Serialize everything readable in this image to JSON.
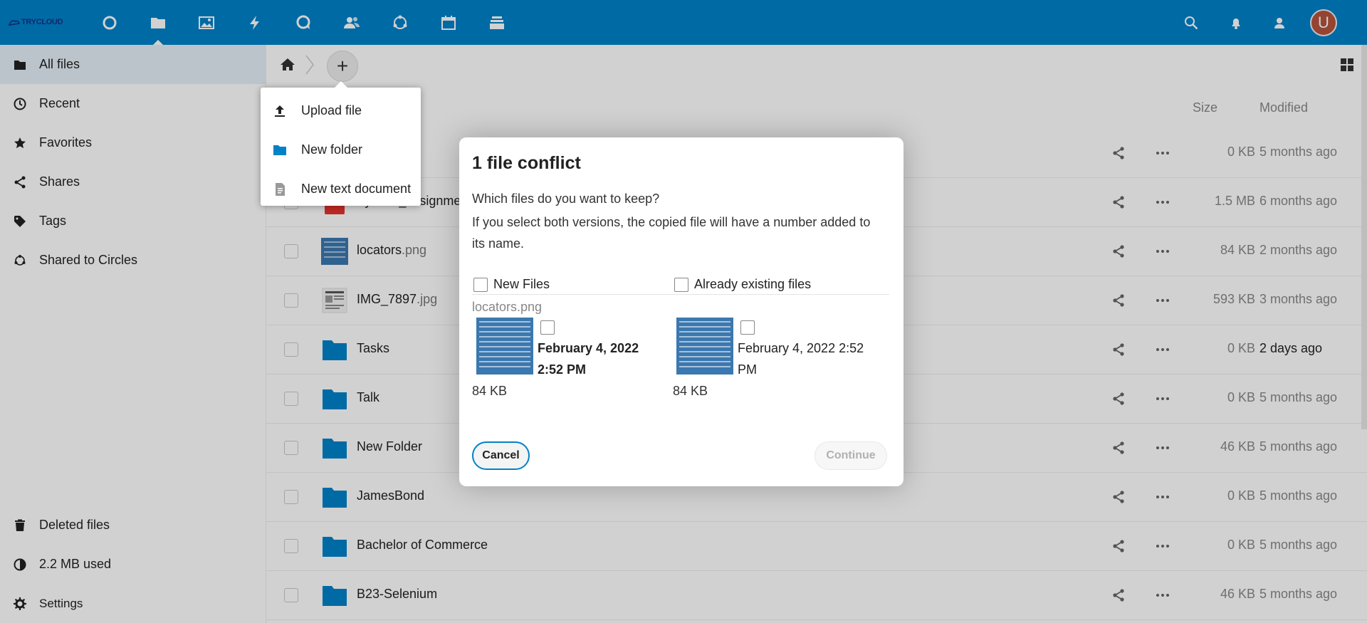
{
  "header": {
    "logo_text": "TRYCLOUD",
    "apps": [
      "dashboard-icon",
      "files-icon",
      "photos-icon",
      "activity-icon",
      "talk-icon",
      "contacts-icon",
      "circles-icon",
      "calendar-icon",
      "deck-icon"
    ],
    "avatar_letter": "U",
    "accent": "#0082c9"
  },
  "sidebar": {
    "items": [
      {
        "label": "All files",
        "icon": "folder-icon"
      },
      {
        "label": "Recent",
        "icon": "clock-icon"
      },
      {
        "label": "Favorites",
        "icon": "star-icon"
      },
      {
        "label": "Shares",
        "icon": "share-icon"
      },
      {
        "label": "Tags",
        "icon": "tag-icon"
      },
      {
        "label": "Shared to Circles",
        "icon": "circles-icon"
      }
    ],
    "bottom": {
      "deleted": "Deleted files",
      "quota": "2.2 MB used",
      "settings": "Settings"
    }
  },
  "files": {
    "columns": {
      "size": "Size",
      "modified": "Modified"
    },
    "rows": [
      {
        "name": "",
        "ext": "",
        "size": "0 KB",
        "modified": "5 months ago"
      },
      {
        "name": "Vytrack_assignment",
        "ext": "",
        "size": "1.5 MB",
        "modified": "6 months ago"
      },
      {
        "name": "locators",
        "ext": ".png",
        "size": "84 KB",
        "modified": "2 months ago"
      },
      {
        "name": "IMG_7897",
        "ext": ".jpg",
        "size": "593 KB",
        "modified": "3 months ago"
      },
      {
        "name": "Tasks",
        "ext": "",
        "size": "0 KB",
        "modified": "2 days ago"
      },
      {
        "name": "Talk",
        "ext": "",
        "size": "0 KB",
        "modified": "5 months ago"
      },
      {
        "name": "New Folder",
        "ext": "",
        "size": "46 KB",
        "modified": "5 months ago"
      },
      {
        "name": "JamesBond",
        "ext": "",
        "size": "0 KB",
        "modified": "5 months ago"
      },
      {
        "name": "Bachelor of Commerce",
        "ext": "",
        "size": "0 KB",
        "modified": "5 months ago"
      },
      {
        "name": "B23-Selenium",
        "ext": "",
        "size": "46 KB",
        "modified": "5 months ago"
      }
    ]
  },
  "new_menu": {
    "upload": "Upload file",
    "folder": "New folder",
    "text": "New text document"
  },
  "dialog": {
    "title": "1 file conflict",
    "question": "Which files do you want to keep?",
    "message": "If you select both versions, the copied file will have a number added to its name.",
    "col_new": "New Files",
    "col_existing": "Already existing files",
    "file_name": "locators.png",
    "new_date": "February 4, 2022 2:52 PM",
    "new_size": "84 KB",
    "existing_date": "February 4, 2022 2:52 PM",
    "existing_size": "84 KB",
    "cancel": "Cancel",
    "continue": "Continue"
  }
}
